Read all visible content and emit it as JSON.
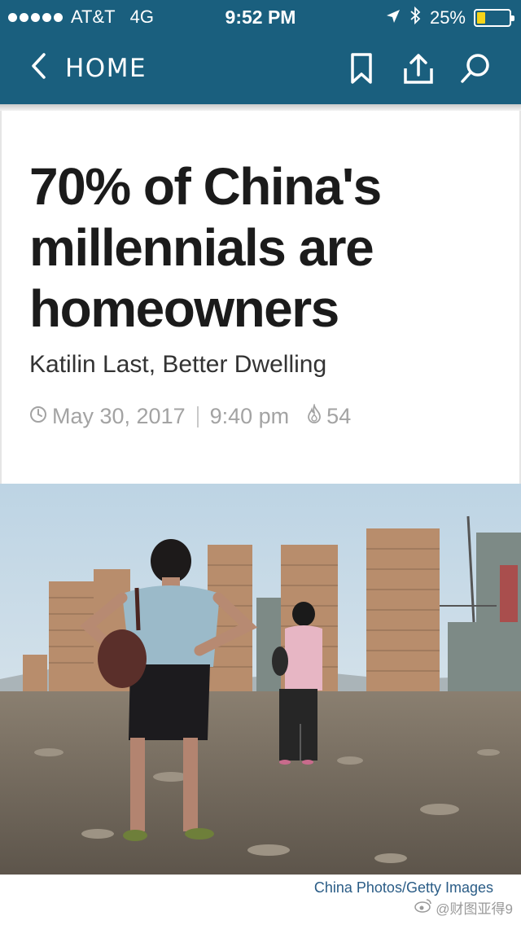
{
  "status_bar": {
    "carrier": "AT&T",
    "network": "4G",
    "time": "9:52 PM",
    "battery_percent": "25%",
    "battery_level": 0.25,
    "icons": [
      "signal-dots-icon",
      "location-arrow-icon",
      "bluetooth-icon",
      "battery-icon"
    ]
  },
  "nav": {
    "back_label": "HOME",
    "icons": [
      "chevron-left-icon",
      "bookmark-icon",
      "share-icon",
      "search-icon"
    ],
    "background": "#1a5f7e"
  },
  "article": {
    "headline": "70% of China's millennials are homeowners",
    "byline": "Katilin Last, Better Dwelling",
    "date": "May 30, 2017",
    "time": "9:40 pm",
    "comment_count": "54"
  },
  "photo": {
    "credit": "China Photos/Getty Images"
  },
  "watermark": "@财图亚得9",
  "colors": {
    "accent": "#1a5f7e",
    "credit_link": "#2a5c86",
    "battery_fill": "#f7d418"
  }
}
